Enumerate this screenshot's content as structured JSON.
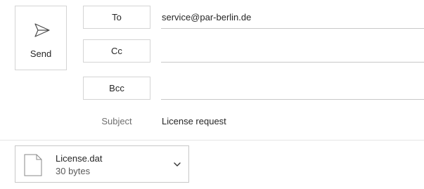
{
  "send": {
    "label": "Send",
    "icon": "send-icon"
  },
  "recipients": {
    "to_label": "To",
    "to_value": "service@par-berlin.de",
    "cc_label": "Cc",
    "cc_value": "",
    "bcc_label": "Bcc",
    "bcc_value": ""
  },
  "subject": {
    "label": "Subject",
    "value": "License request"
  },
  "attachment": {
    "name": "License.dat",
    "size": "30 bytes",
    "icon": "file-icon",
    "menu_icon": "chevron-down-icon"
  }
}
